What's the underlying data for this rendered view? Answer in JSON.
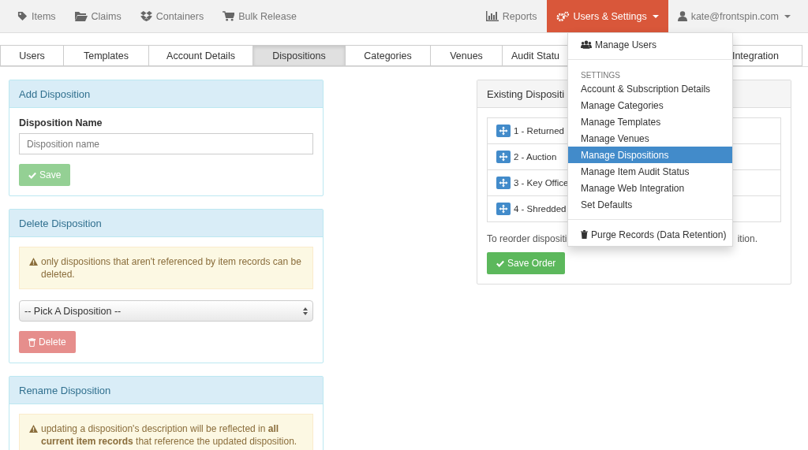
{
  "navbar": {
    "left_items": [
      {
        "label": "Items"
      },
      {
        "label": "Claims"
      },
      {
        "label": "Containers"
      },
      {
        "label": "Bulk Release"
      }
    ],
    "reports": {
      "label": "Reports"
    },
    "settings_menu": {
      "label": "Users & Settings",
      "expanded": true,
      "sections": [
        {
          "items": [
            {
              "label": "Manage Users",
              "selected": false
            }
          ]
        },
        {
          "header": "SETTINGS",
          "items": [
            {
              "label": "Account & Subscription Details",
              "selected": false
            },
            {
              "label": "Manage Categories",
              "selected": false
            },
            {
              "label": "Manage Templates",
              "selected": false
            },
            {
              "label": "Manage Venues",
              "selected": false
            },
            {
              "label": "Manage Dispositions",
              "selected": true
            },
            {
              "label": "Manage Item Audit Status",
              "selected": false
            },
            {
              "label": "Manage Web Integration",
              "selected": false
            },
            {
              "label": "Set Defaults",
              "selected": false
            }
          ]
        },
        {
          "items": [
            {
              "label": "Purge Records (Data Retention)",
              "selected": false
            }
          ]
        }
      ]
    },
    "user": {
      "label": "kate@frontspin.com"
    }
  },
  "tabs": [
    {
      "label": "Users",
      "selected": false
    },
    {
      "label": "Templates",
      "selected": false
    },
    {
      "label": "Account Details",
      "selected": false
    },
    {
      "label": "Dispositions",
      "selected": true
    },
    {
      "label": "Categories",
      "selected": false
    },
    {
      "label": "Venues",
      "selected": false
    },
    {
      "label": "Audit Statu",
      "selected": false
    },
    {
      "label": "Integration",
      "selected": false
    }
  ],
  "add_panel": {
    "title": "Add Disposition",
    "field_label": "Disposition Name",
    "placeholder": "Disposition name",
    "button": {
      "label": "Save",
      "disabled": true
    }
  },
  "delete_panel": {
    "title": "Delete Disposition",
    "warning": "only dispositions that aren't referenced by item records can be deleted.",
    "select_value": "-- Pick A Disposition --",
    "button": {
      "label": "Delete",
      "disabled": true
    }
  },
  "rename_panel": {
    "title": "Rename Disposition",
    "warning": "updating a disposition's description will be reflected in **all current item records** that reference the updated disposition."
  },
  "existing_panel": {
    "title": "Existing Dispositi",
    "items": [
      "1 - Returned",
      "2 - Auction",
      "3 - Key Office",
      "4 - Shredded"
    ],
    "hint_left": "To reorder dispositi",
    "hint_right": "ition.",
    "button": {
      "label": "Save Order",
      "disabled": false
    }
  }
}
